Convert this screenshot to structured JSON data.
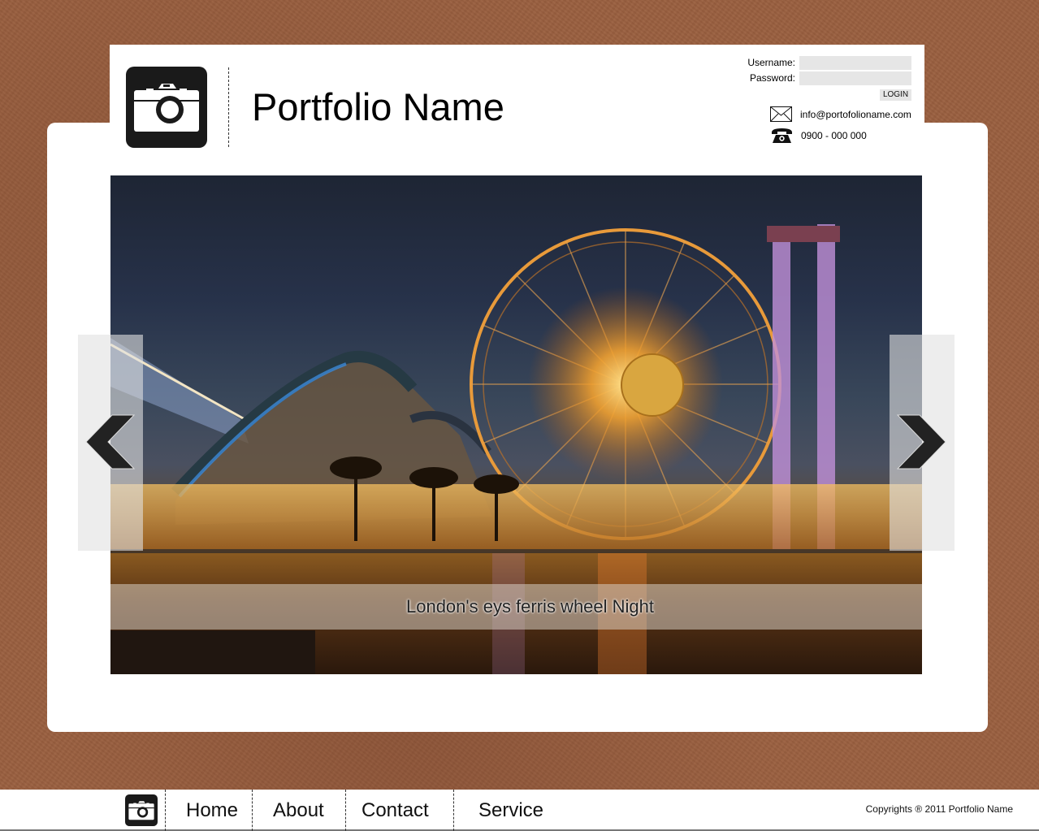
{
  "header": {
    "site_title": "Portfolio Name",
    "logo_icon": "camera-icon"
  },
  "login": {
    "username_label": "Username:",
    "username_value": "",
    "password_label": "Password:",
    "password_value": "",
    "login_button": "LOGIN"
  },
  "contact": {
    "email_icon": "envelope-icon",
    "email": "info@portofolioname.com",
    "phone_icon": "telephone-icon",
    "phone": "0900 - 000 000"
  },
  "slider": {
    "caption": "London's eys ferris wheel Night",
    "prev_icon": "chevron-left-icon",
    "next_icon": "chevron-right-icon"
  },
  "footer": {
    "nav": [
      {
        "label": "Home"
      },
      {
        "label": "About"
      },
      {
        "label": "Contact"
      },
      {
        "label": "Service"
      }
    ],
    "copyright": "Copyrights ® 2011 Portfolio Name"
  },
  "colors": {
    "background": "#9a5f3f",
    "panel": "#ffffff",
    "logo": "#1a1a1a",
    "input_bg": "#e6e6e6"
  }
}
